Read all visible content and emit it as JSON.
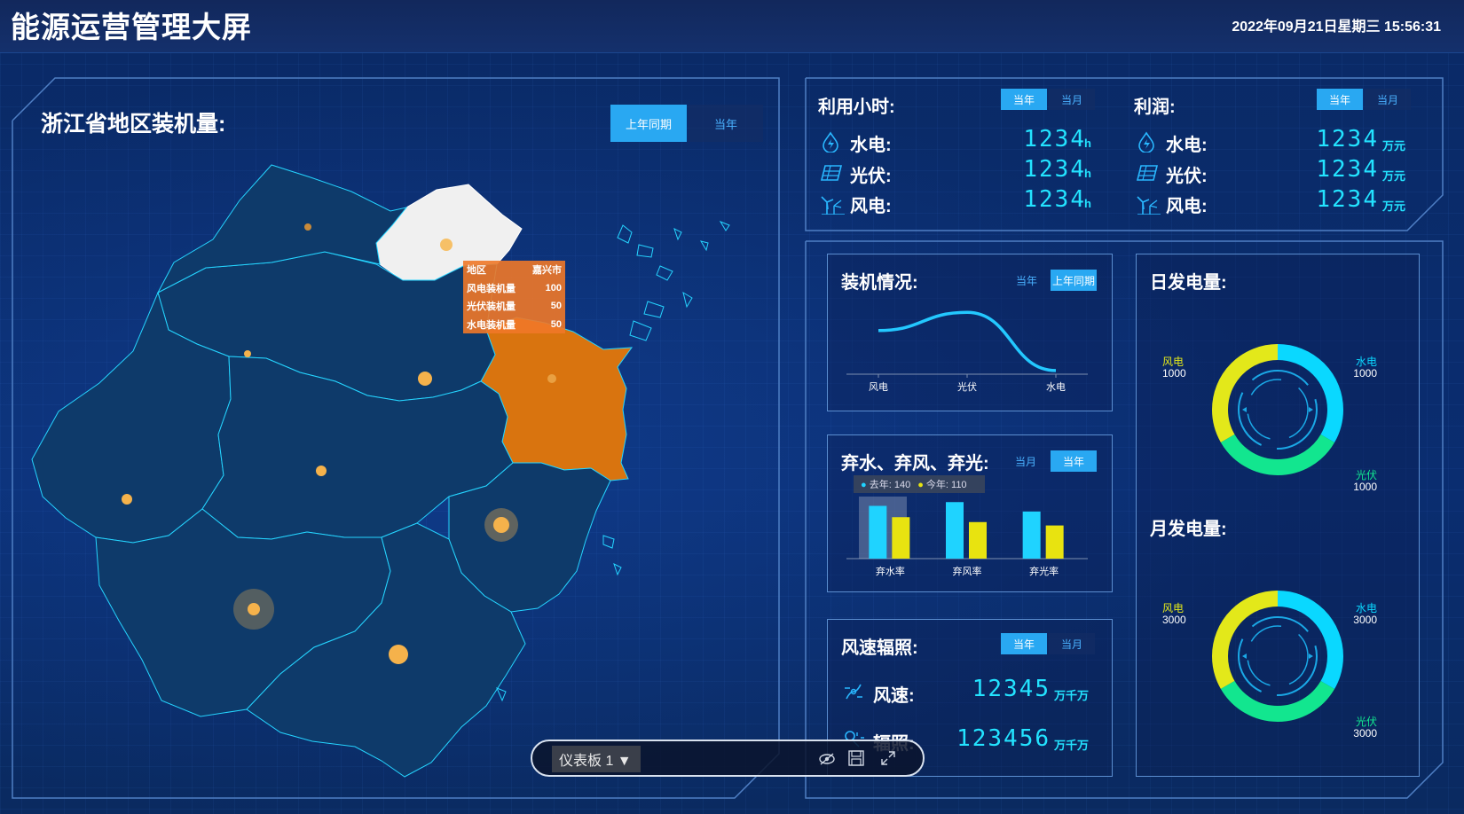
{
  "header": {
    "title": "能源运营管理大屏",
    "datetime": "2022年09月21日星期三 15:56:31"
  },
  "map_panel": {
    "title": "浙江省地区装机量:",
    "btn_last_year": "上年同期",
    "btn_this_year": "当年",
    "tooltip": {
      "rows": [
        {
          "label": "地区",
          "value": "嘉兴市"
        },
        {
          "label": "风电装机量",
          "value": "100"
        },
        {
          "label": "光伏装机量",
          "value": "50"
        },
        {
          "label": "水电装机量",
          "value": "50"
        }
      ]
    },
    "colors": {
      "selected": "#f0f0f0",
      "highlight": "#d9740f",
      "region": "#0e3a6a",
      "border": "#25d4ff"
    }
  },
  "utilization": {
    "title": "利用小时:",
    "btn_year": "当年",
    "btn_month": "当月",
    "items": [
      {
        "label": "水电:",
        "value": "1234",
        "unit": "h",
        "icon": "water-drop-icon"
      },
      {
        "label": "光伏:",
        "value": "1234",
        "unit": "h",
        "icon": "solar-panel-icon"
      },
      {
        "label": "风电:",
        "value": "1234",
        "unit": "h",
        "icon": "wind-turbine-icon"
      }
    ]
  },
  "profit": {
    "title": "利润:",
    "btn_year": "当年",
    "btn_month": "当月",
    "items": [
      {
        "label": "水电:",
        "value": "1234",
        "unit": "万元",
        "icon": "water-drop-icon"
      },
      {
        "label": "光伏:",
        "value": "1234",
        "unit": "万元",
        "icon": "solar-panel-icon"
      },
      {
        "label": "风电:",
        "value": "1234",
        "unit": "万元",
        "icon": "wind-turbine-icon"
      }
    ]
  },
  "install": {
    "title": "装机情况:",
    "btn_year": "当年",
    "btn_last_year": "上年同期"
  },
  "curtail": {
    "title": "弃水、弃风、弃光:",
    "btn_month": "当月",
    "btn_year": "当年",
    "tooltip_last": "去年: 140",
    "tooltip_this": "今年: 110"
  },
  "wind_irr": {
    "title": "风速辐照:",
    "btn_year": "当年",
    "btn_month": "当月",
    "wind_label": "风速:",
    "wind_value": "12345",
    "wind_unit": "万千万",
    "irr_label": "辐照:",
    "irr_value": "123456",
    "irr_unit": "万千万"
  },
  "daily_power": {
    "title": "日发电量:"
  },
  "monthly_power": {
    "title": "月发电量:"
  },
  "toolbar": {
    "dashboard_label": "仪表板 1 ▼"
  },
  "chart_data": [
    {
      "type": "line",
      "categories": [
        "风电",
        "光伏",
        "水电"
      ],
      "values": [
        60,
        85,
        5
      ],
      "ylim": [
        0,
        100
      ],
      "color": "#23c8ff"
    },
    {
      "type": "bar",
      "categories": [
        "弃水率",
        "弃风率",
        "弃光率"
      ],
      "series": [
        {
          "name": "去年",
          "values": [
            140,
            150,
            125
          ],
          "color": "#1fd3ff"
        },
        {
          "name": "今年",
          "values": [
            110,
            97,
            88
          ],
          "color": "#e8e310"
        }
      ],
      "ylim": [
        0,
        160
      ]
    },
    {
      "type": "pie",
      "title": "日发电量:",
      "slices": [
        {
          "name": "水电",
          "value": 1000,
          "color": "#0ad8ff"
        },
        {
          "name": "光伏",
          "value": 1000,
          "color": "#12e68f"
        },
        {
          "name": "风电",
          "value": 1000,
          "color": "#e3e81a"
        }
      ]
    },
    {
      "type": "pie",
      "title": "月发电量:",
      "slices": [
        {
          "name": "水电",
          "value": 3000,
          "color": "#0ad8ff"
        },
        {
          "name": "光伏",
          "value": 3000,
          "color": "#12e68f"
        },
        {
          "name": "风电",
          "value": 3000,
          "color": "#e3e81a"
        }
      ]
    }
  ]
}
